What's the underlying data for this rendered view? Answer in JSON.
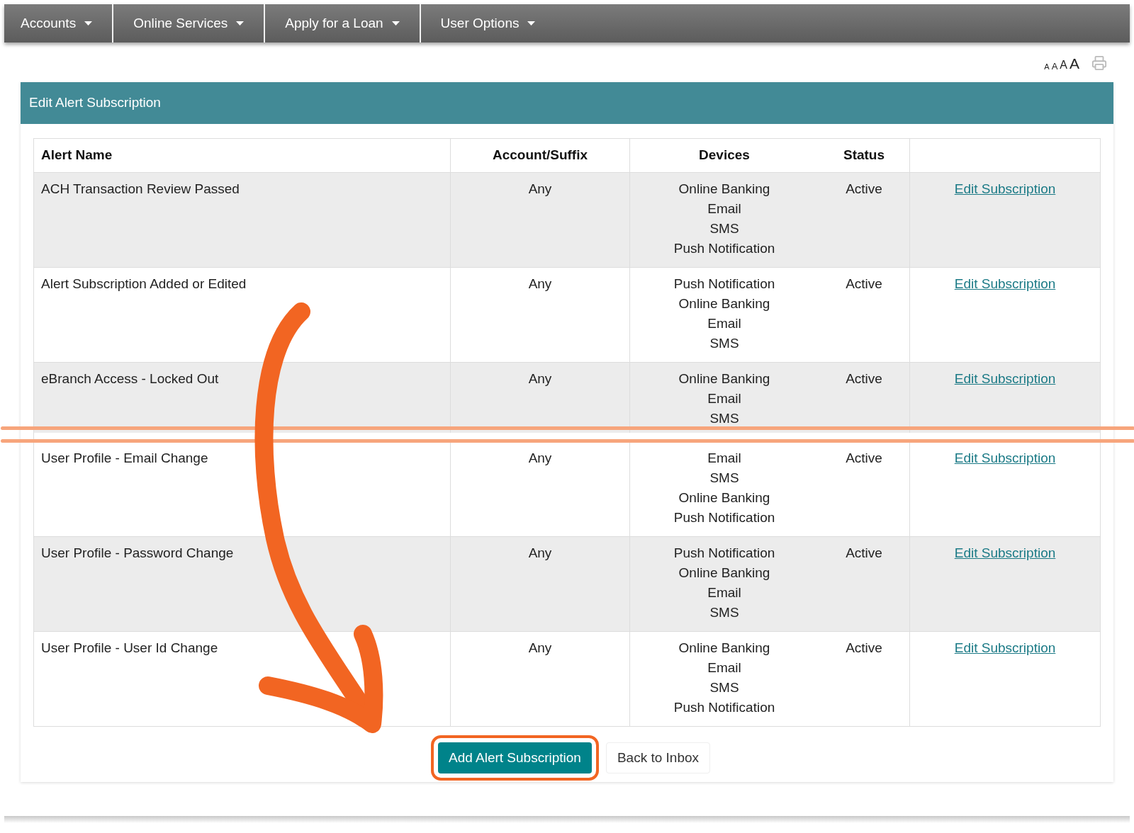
{
  "nav": [
    {
      "label": "Accounts"
    },
    {
      "label": "Online Services"
    },
    {
      "label": "Apply for a Loan"
    },
    {
      "label": "User Options"
    }
  ],
  "font_sizes": [
    "A",
    "A",
    "A",
    "A"
  ],
  "panel": {
    "title": "Edit Alert Subscription"
  },
  "table": {
    "columns": [
      "Alert Name",
      "Account/Suffix",
      "Devices",
      "Status"
    ],
    "rows": [
      {
        "name": "ACH Transaction Review Passed",
        "account": "Any",
        "devices": [
          "Online Banking",
          "Email",
          "SMS",
          "Push Notification"
        ],
        "status": "Active",
        "action": "Edit Subscription"
      },
      {
        "name": "Alert Subscription Added or Edited",
        "account": "Any",
        "devices": [
          "Push Notification",
          "Online Banking",
          "Email",
          "SMS"
        ],
        "status": "Active",
        "action": "Edit Subscription"
      },
      {
        "name": "eBranch Access - Locked Out",
        "account": "Any",
        "devices": [
          "Online Banking",
          "Email",
          "SMS"
        ],
        "status": "Active",
        "action": "Edit Subscription",
        "cut": true
      },
      {
        "name": "User Profile - Email Change",
        "account": "Any",
        "devices": [
          "Email",
          "SMS",
          "Online Banking",
          "Push Notification"
        ],
        "status": "Active",
        "action": "Edit Subscription"
      },
      {
        "name": "User Profile - Password Change",
        "account": "Any",
        "devices": [
          "Push Notification",
          "Online Banking",
          "Email",
          "SMS"
        ],
        "status": "Active",
        "action": "Edit Subscription"
      },
      {
        "name": "User Profile - User Id Change",
        "account": "Any",
        "devices": [
          "Online Banking",
          "Email",
          "SMS",
          "Push Notification"
        ],
        "status": "Active",
        "action": "Edit Subscription"
      }
    ]
  },
  "buttons": [
    {
      "label": "Add Alert Subscription",
      "kind": "primary",
      "highlighted": true
    },
    {
      "label": "Back to Inbox",
      "kind": "secondary",
      "highlighted": false
    }
  ]
}
